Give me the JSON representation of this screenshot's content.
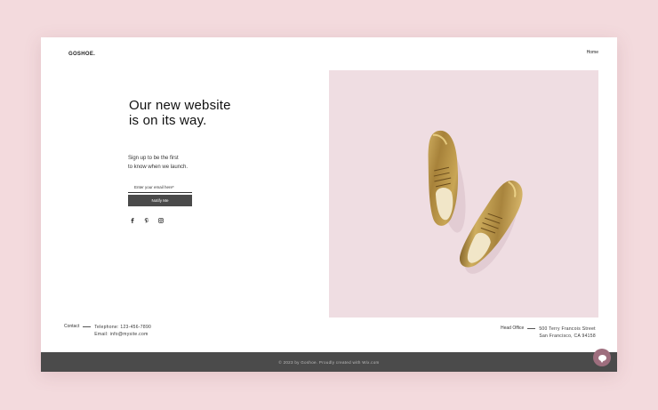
{
  "header": {
    "logo": "GOSHOE.",
    "nav_home": "Home"
  },
  "hero": {
    "headline": "Our new website is on its way.",
    "subtext_line1": "Sign up to be the first",
    "subtext_line2": "to know when we launch.",
    "email_placeholder": "Enter your email here*",
    "notify_label": "Notify Me"
  },
  "socials": [
    {
      "name": "facebook-icon",
      "glyph": "f"
    },
    {
      "name": "pinterest-icon",
      "glyph": "p"
    },
    {
      "name": "instagram-icon",
      "glyph": "instagram"
    }
  ],
  "contact": {
    "label": "Contact",
    "telephone": "Telephone: 123-456-7890",
    "email": "Email: info@mysite.com"
  },
  "office": {
    "label": "Head Office",
    "street": "500 Terry Francois Street",
    "city": "San Francisco, CA 94158"
  },
  "footer": {
    "text": "© 2023 by Goshoe. Proudly created with Wix.com"
  },
  "colors": {
    "page_background": "#f3dadd",
    "photo_background": "#efdde2",
    "footer": "#4b4b4b",
    "chat_button": "#9e6e7e"
  }
}
